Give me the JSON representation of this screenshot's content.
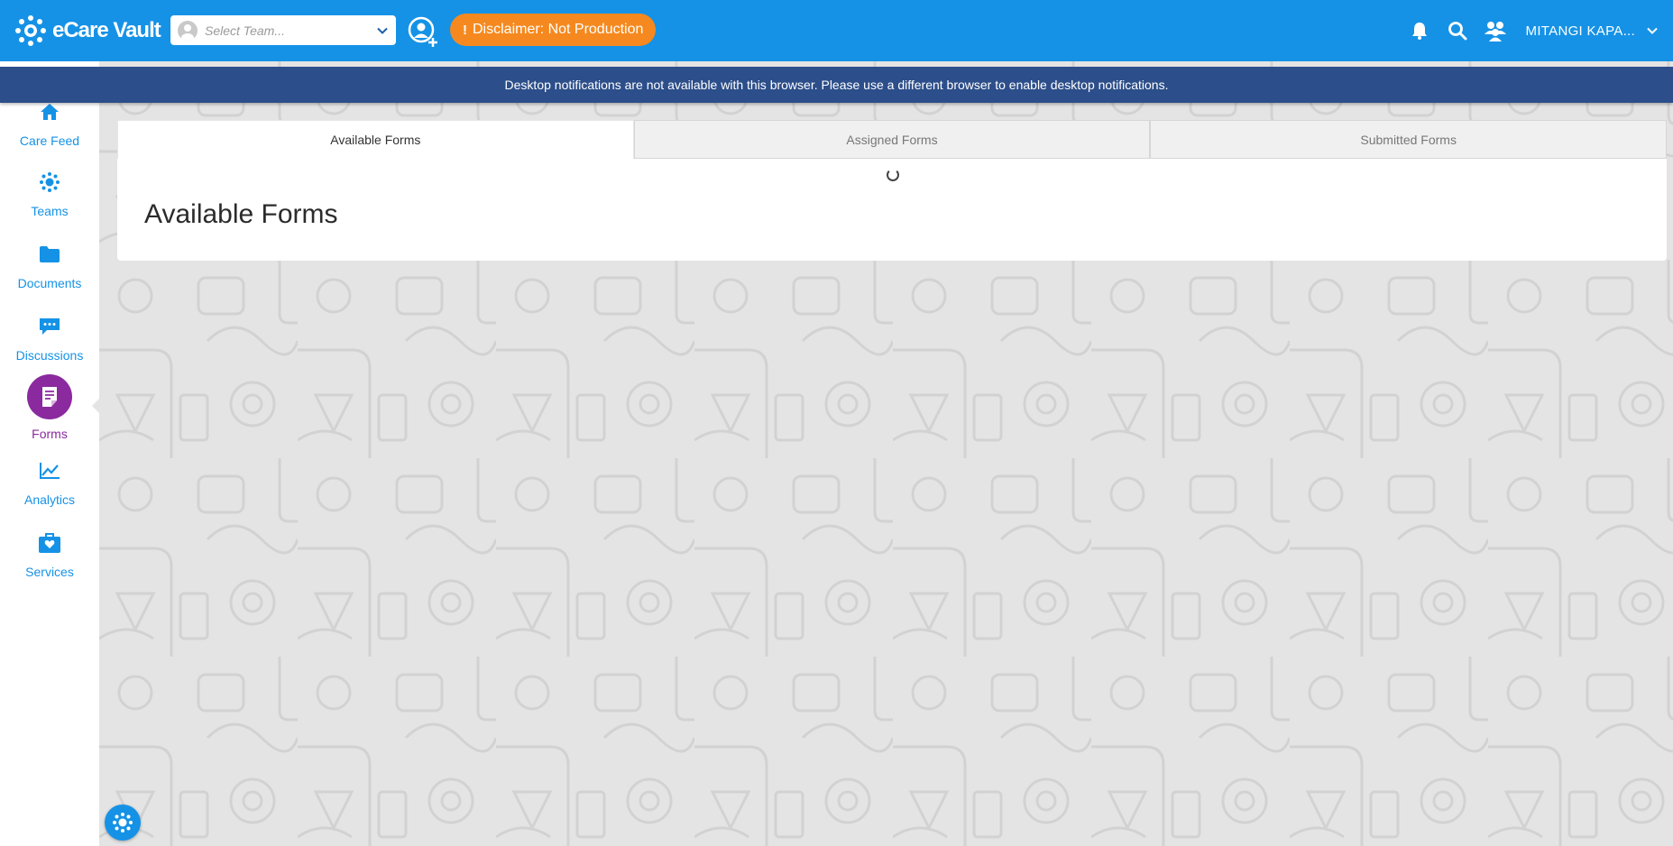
{
  "app": {
    "name": "eCare Vault"
  },
  "header": {
    "team_select": {
      "placeholder": "Select Team..."
    },
    "disclaimer": {
      "icon_text": "!",
      "label": "Disclaimer: Not Production"
    },
    "user": {
      "name": "MITANGI KAPA..."
    },
    "icons": [
      "add-user-icon",
      "bell-icon",
      "search-icon",
      "people-icon",
      "chevron-down-icon"
    ]
  },
  "banner": {
    "message": "Desktop notifications are not available with this browser. Please use a different browser to enable desktop notifications."
  },
  "sidebar": {
    "items": [
      {
        "label": "Care Feed",
        "icon": "home-icon"
      },
      {
        "label": "Teams",
        "icon": "teams-icon"
      },
      {
        "label": "Documents",
        "icon": "folder-icon"
      },
      {
        "label": "Discussions",
        "icon": "chat-icon"
      },
      {
        "label": "Forms",
        "icon": "form-icon",
        "active": true
      },
      {
        "label": "Analytics",
        "icon": "chart-icon"
      },
      {
        "label": "Services",
        "icon": "services-icon"
      }
    ]
  },
  "forms_page": {
    "tabs": [
      {
        "label": "Available Forms",
        "active": true
      },
      {
        "label": "Assigned Forms"
      },
      {
        "label": "Submitted Forms"
      }
    ],
    "title": "Available Forms"
  },
  "colors": {
    "brand_blue": "#1592e6",
    "banner_navy": "#2c4e8a",
    "disclaimer_orange": "#f5891f",
    "active_purple": "#8a2a9e"
  }
}
